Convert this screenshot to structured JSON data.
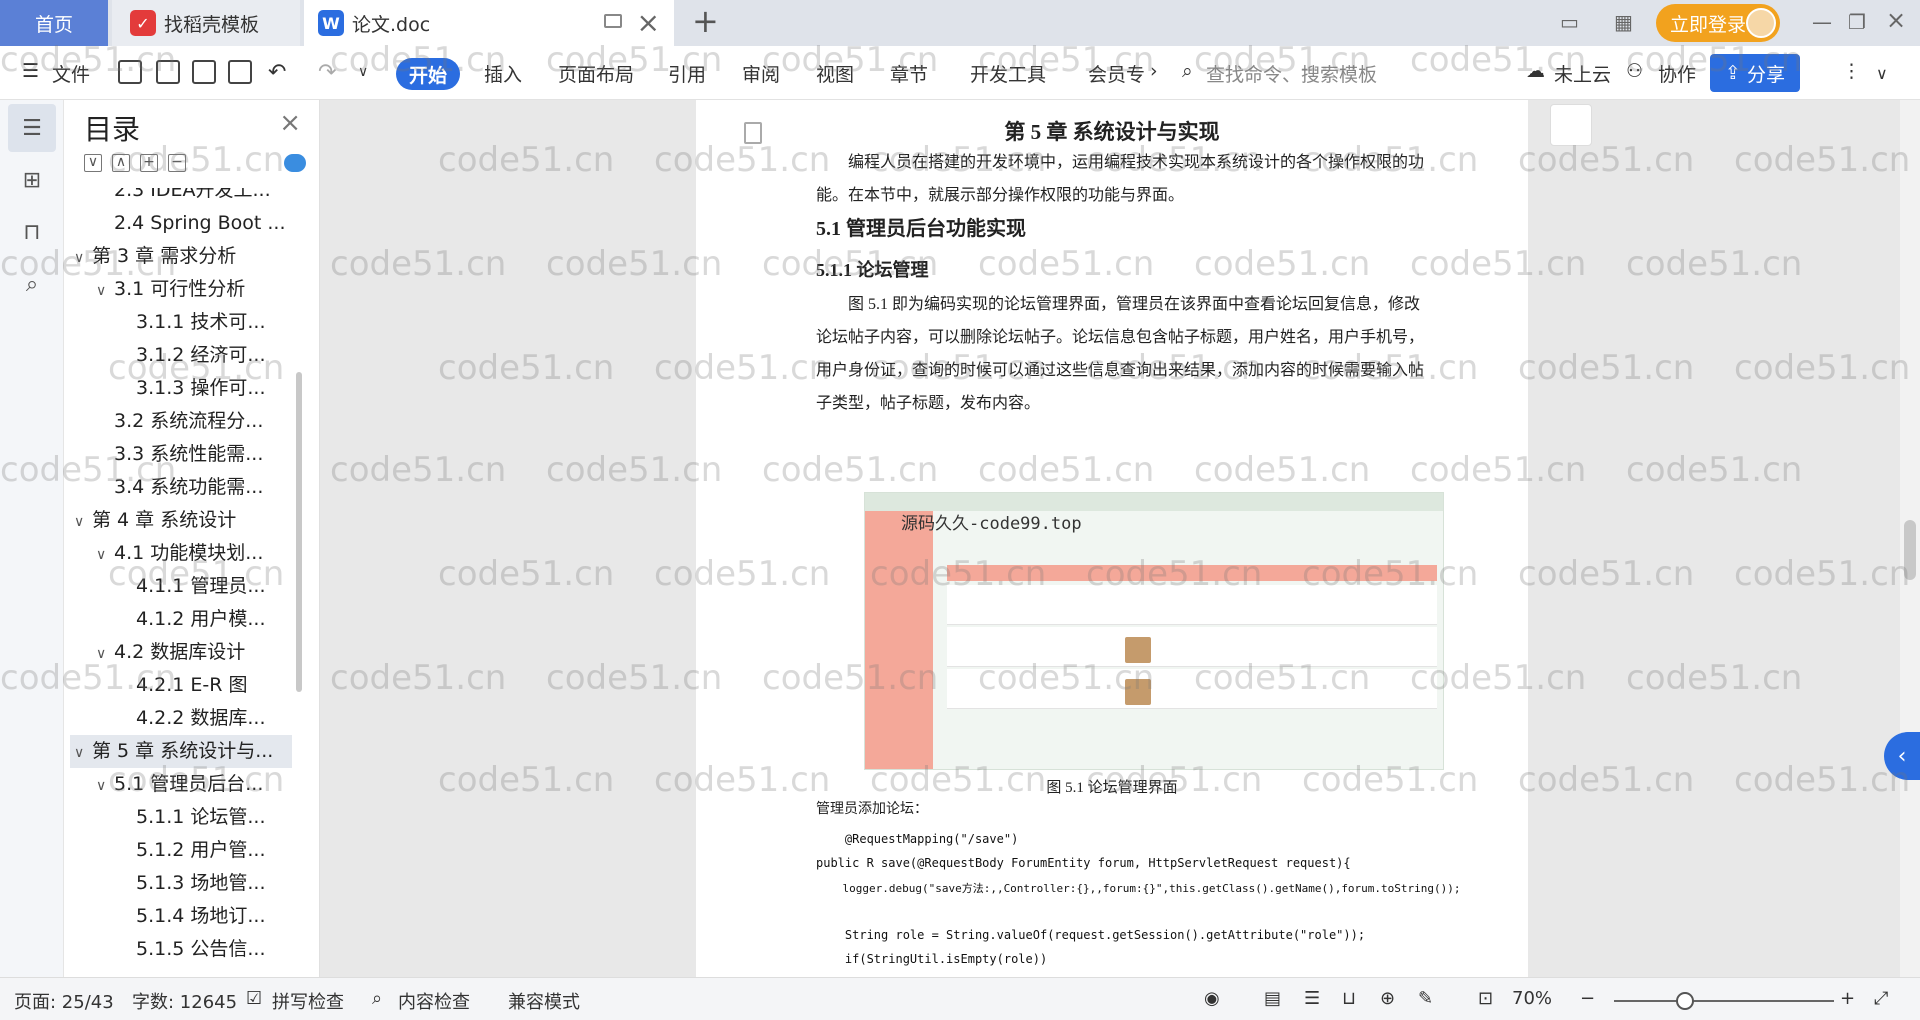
{
  "tabs": {
    "home": "首页",
    "template": "找稻壳模板",
    "doc": "论文.doc",
    "login": "立即登录"
  },
  "toolbar": {
    "file": "文件",
    "active": "开始",
    "items": [
      "插入",
      "页面布局",
      "引用",
      "审阅",
      "视图",
      "章节",
      "开发工具",
      "会员专"
    ],
    "search_placeholder": "查找命令、搜索模板",
    "cloud": "未上云",
    "collab": "协作",
    "share": "分享"
  },
  "toc": {
    "title": "目录",
    "items": [
      {
        "label": "2.3 IDEA开发工...",
        "level": 2,
        "caret": ""
      },
      {
        "label": "2.4 Spring Boot ...",
        "level": 2,
        "caret": ""
      },
      {
        "label": "第 3 章  需求分析",
        "level": 1,
        "caret": "∨"
      },
      {
        "label": "3.1  可行性分析",
        "level": 2,
        "caret": "∨"
      },
      {
        "label": "3.1.1  技术可...",
        "level": 3,
        "caret": ""
      },
      {
        "label": "3.1.2  经济可...",
        "level": 3,
        "caret": ""
      },
      {
        "label": "3.1.3  操作可...",
        "level": 3,
        "caret": ""
      },
      {
        "label": "3.2  系统流程分...",
        "level": 2,
        "caret": ""
      },
      {
        "label": "3.3  系统性能需...",
        "level": 2,
        "caret": ""
      },
      {
        "label": "3.4  系统功能需...",
        "level": 2,
        "caret": ""
      },
      {
        "label": "第 4 章  系统设计",
        "level": 1,
        "caret": "∨"
      },
      {
        "label": "4.1  功能模块划...",
        "level": 2,
        "caret": "∨"
      },
      {
        "label": "4.1.1  管理员...",
        "level": 3,
        "caret": ""
      },
      {
        "label": "4.1.2  用户模...",
        "level": 3,
        "caret": ""
      },
      {
        "label": "4.2  数据库设计",
        "level": 2,
        "caret": "∨"
      },
      {
        "label": "4.2.1  E-R 图",
        "level": 3,
        "caret": ""
      },
      {
        "label": "4.2.2  数据库...",
        "level": 3,
        "caret": ""
      },
      {
        "label": "第 5 章  系统设计与...",
        "level": 1,
        "caret": "∨",
        "selected": true
      },
      {
        "label": "5.1  管理员后台...",
        "level": 2,
        "caret": "∨"
      },
      {
        "label": "5.1.1  论坛管...",
        "level": 3,
        "caret": ""
      },
      {
        "label": "5.1.2  用户管...",
        "level": 3,
        "caret": ""
      },
      {
        "label": "5.1.3  场地管...",
        "level": 3,
        "caret": ""
      },
      {
        "label": "5.1.4  场地订...",
        "level": 3,
        "caret": ""
      },
      {
        "label": "5.1.5  公告信...",
        "level": 3,
        "caret": ""
      }
    ]
  },
  "document": {
    "chapter": "第 5 章  系统设计与实现",
    "intro": "编程人员在搭建的开发环境中，运用编程技术实现本系统设计的各个操作权限的功能。在本节中，就展示部分操作权限的功能与界面。",
    "h2": "5.1  管理员后台功能实现",
    "h3": "5.1.1  论坛管理",
    "body": "图 5.1  即为编码实现的论坛管理界面，管理员在该界面中查看论坛回复信息，修改论坛帖子内容，可以删除论坛帖子。论坛信息包含帖子标题，用户姓名，用户手机号，用户身份证，查询的时候可以通过这些信息查询出来结果，添加内容的时候需要输入帖子类型，帖子标题，发布内容。",
    "figure_watermark": "源码久久-code99.top",
    "caption": "图 5.1  论坛管理界面",
    "code_intro": "管理员添加论坛：",
    "code": [
      "    @RequestMapping(\"/save\")",
      "public R save(@RequestBody ForumEntity forum, HttpServletRequest request){",
      "    logger.debug(\"save方法:,,Controller:{},,forum:{}\",this.getClass().getName(),forum.toString());",
      "",
      "    String role = String.valueOf(request.getSession().getAttribute(\"role\"));",
      "    if(StringUtil.isEmpty(role))"
    ]
  },
  "status": {
    "page": "页面: 25/43",
    "words": "字数: 12645",
    "spell": "拼写检查",
    "content": "内容检查",
    "compat": "兼容模式",
    "zoom": "70%"
  },
  "watermark": "code51.cn",
  "colors": {
    "accent": "#2b6de0",
    "login": "#f2a21e",
    "home_tab": "#5b80d6"
  }
}
